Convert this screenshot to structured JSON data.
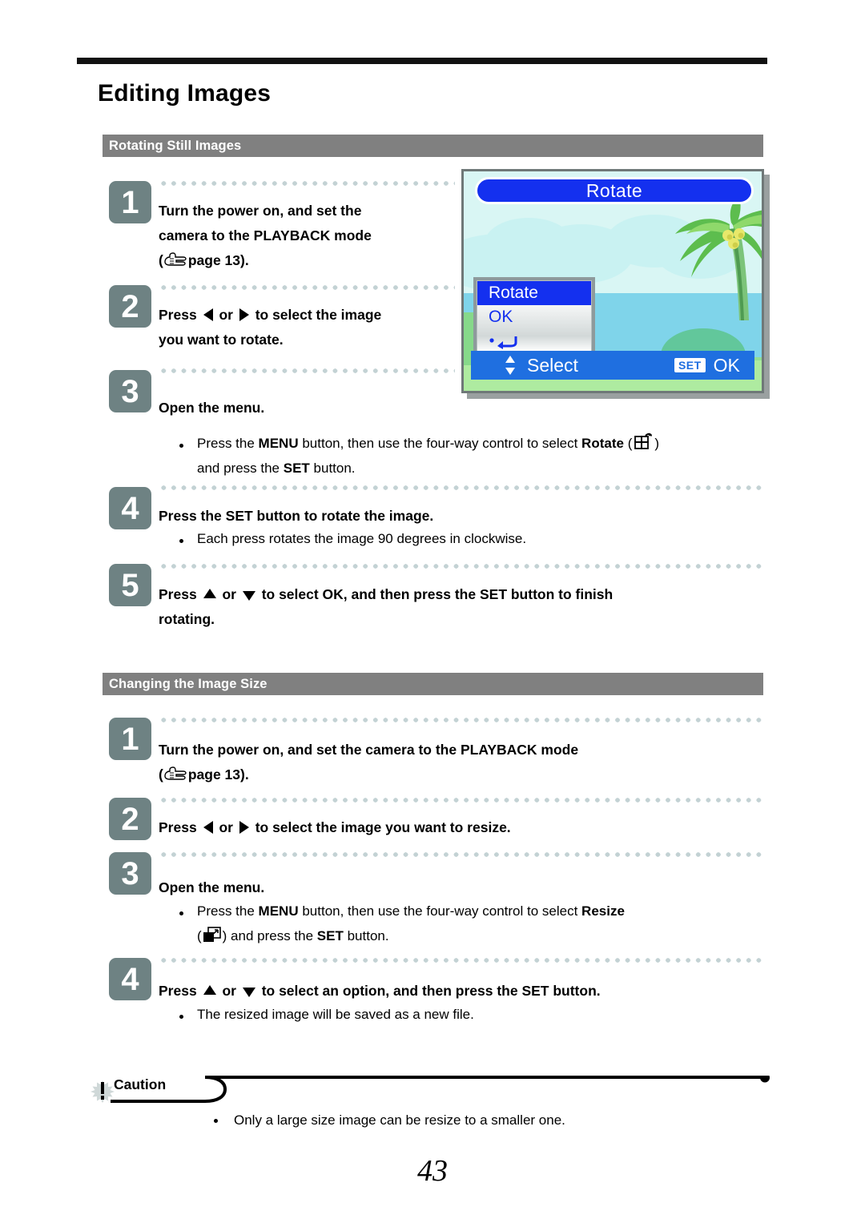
{
  "document": {
    "page_title": "Editing Images",
    "page_number": "43"
  },
  "sections": [
    {
      "heading": "Rotating Still Images",
      "steps": [
        {
          "number": "1",
          "text_before_icon": "Turn the power on, and set the camera to the PLAYBACK mode (",
          "icon": "pointing-hand-icon",
          "text_after_icon": "page 13).",
          "bullets": []
        },
        {
          "number": "2",
          "text_parts": [
            "Press ",
            " or ",
            " to select the image you want to rotate."
          ],
          "bullets": []
        },
        {
          "number": "3",
          "text": "Open the menu.",
          "bullets": [
            {
              "pre": "Press the ",
              "bold1": "MENU",
              "mid": " button, then use the four-way control to select ",
              "bold2": "Rotate",
              "icon": "rotate-icon",
              "post_pre": " ) and press the ",
              "bold3": "SET",
              "post": " button."
            }
          ]
        },
        {
          "number": "4",
          "text": "Press the SET button to rotate the image.",
          "bullets": [
            {
              "plain": "Each press rotates the image 90 degrees in clockwise."
            }
          ]
        },
        {
          "number": "5",
          "text_parts": [
            "Press ",
            " or ",
            " to select OK, and then press the SET button to finish rotating."
          ],
          "bullets": []
        }
      ]
    },
    {
      "heading": "Changing the Image Size",
      "steps": [
        {
          "number": "1",
          "text_before_icon": "Turn the power on, and set the camera to the PLAYBACK mode (",
          "icon": "pointing-hand-icon",
          "text_after_icon": "page 13).",
          "bullets": []
        },
        {
          "number": "2",
          "text_parts": [
            "Press ",
            " or ",
            " to select the image you want to resize."
          ],
          "bullets": []
        },
        {
          "number": "3",
          "text": "Open the menu.",
          "bullets": [
            {
              "pre": "Press the ",
              "bold1": "MENU",
              "mid": " button, then use the four-way control to select ",
              "bold2": "Resize",
              "icon": "resize-icon",
              "post_pre": ") and press the ",
              "bold3": "SET",
              "post": " button."
            }
          ]
        },
        {
          "number": "4",
          "text_parts": [
            "Press ",
            " or ",
            " to select an option, and then press the SET button."
          ],
          "bullets": [
            {
              "plain": "The resized image will be saved as a new file."
            }
          ]
        }
      ]
    }
  ],
  "labels": {
    "step1_line1": "Turn the power on, and set the",
    "step1_line2": "camera to the PLAYBACK mode",
    "step1_paren_open": "(",
    "step1_page": "page 13).",
    "s1_step2_pre": "Press",
    "s1_step2_mid": "or",
    "s1_step2_post_a": "to select the image",
    "s1_step2_post_b": "you want to rotate.",
    "open_the_menu": "Open the menu.",
    "s1_b_pre": "Press the ",
    "menu_bold": "MENU",
    "s1_b_mid": " button, then use the four-way control to select ",
    "rotate_bold": "Rotate",
    "paren_open": "(",
    "paren_close": ")",
    "s1_b_post_pre": "and press the ",
    "set_bold": "SET",
    "s1_b_post": " button.",
    "s1_step4": "Press the SET button to rotate the image.",
    "s1_step4_bullet": "Each press rotates the image 90 degrees in clockwise.",
    "s1_step5_pre": "Press",
    "s1_step5_mid": "or",
    "s1_step5_post_a": "to select OK, and then press the SET button to finish",
    "s1_step5_post_b": "rotating.",
    "s2_step1_line1": "Turn the power on, and set the camera to the PLAYBACK mode",
    "s2_step2_pre": "Press",
    "s2_step2_mid": "or",
    "s2_step2_post": "to select the image you want to resize.",
    "resize_bold": "Resize",
    "s2_b_post_pre": ") and press the ",
    "s2_step4_pre": "Press",
    "s2_step4_mid": "or",
    "s2_step4_post": "to select an option, and then press the SET button.",
    "s2_step4_bullet": "The resized image will be saved as a new file.",
    "caution_title": "Caution",
    "caution_bullet": "Only a large size image can be resize to a smaller one."
  },
  "camera_lcd": {
    "title": "Rotate",
    "menu_items": [
      {
        "label": "Rotate",
        "selected": true
      },
      {
        "label": "OK",
        "selected": false
      },
      {
        "label": "return-arrow-icon",
        "selected": false
      }
    ],
    "bottom_bar": {
      "nav_icon": "up-down-arrows-icon",
      "nav_label": "Select",
      "set_badge": "SET",
      "set_label": "OK"
    },
    "scene": "beach-with-palm-tree"
  },
  "colors": {
    "section_bar": "#808080",
    "step_badge": "#6e8283",
    "dot_line": "#c3d2d4",
    "lcd_blue": "#1430ef",
    "lcd_bar_blue": "#1f6fe0"
  }
}
